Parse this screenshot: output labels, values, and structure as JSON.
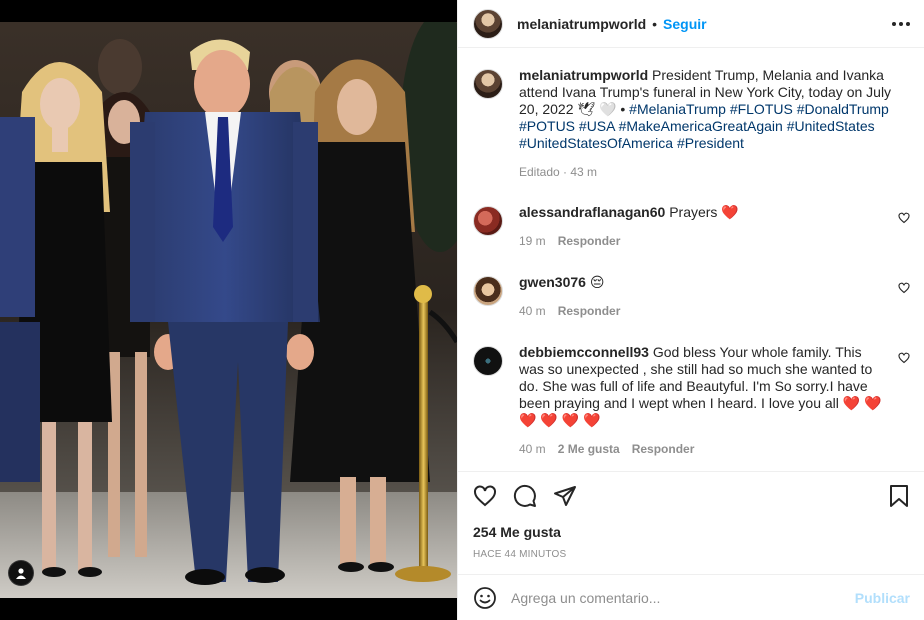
{
  "post": {
    "username": "melaniatrumpworld",
    "follow_label": "Seguir",
    "dot": "•",
    "caption": "President Trump, Melania and Ivanka attend Ivana Trump's funeral in New York City, today on July 20, 2022",
    "caption_sep": "🕊 🤍 •",
    "hashtags": [
      "#MelaniaTrump",
      "#FLOTUS",
      "#DonaldTrump",
      "#POTUS",
      "#USA",
      "#MakeAmericaGreatAgain",
      "#UnitedStates",
      "#UnitedStatesOfAmerica",
      "#President"
    ],
    "caption_meta": "Editado · 43 m"
  },
  "comments": [
    {
      "username": "alessandraflanagan60",
      "text": "Prayers ❤️",
      "time": "19 m",
      "reply": "Responder"
    },
    {
      "username": "gwen3076",
      "text": "😔",
      "time": "40 m",
      "reply": "Responder"
    },
    {
      "username": "debbiemcconnell93",
      "text": "God bless Your whole family. This was so unexpected , she still had so much she wanted to do. She was full of life and Beautyful. I'm So sorry.I have been praying and I wept when I heard. I love you all ❤️ ❤️ ❤️ ❤️ ❤️ ❤️",
      "time": "40 m",
      "likes": "2 Me gusta",
      "reply": "Responder"
    }
  ],
  "actions": {
    "icons": [
      "heart-icon",
      "comment-icon",
      "share-icon",
      "bookmark-icon"
    ],
    "likes": "254 Me gusta",
    "time": "HACE 44 MINUTOS"
  },
  "composer": {
    "placeholder": "Agrega un comentario...",
    "publish": "Publicar",
    "emoji_icon": "smiley-icon"
  },
  "colors": {
    "accent": "#0095f6",
    "publish_disabled": "#b2dffc",
    "hashtag": "#00376b",
    "muted": "#8e8e8e"
  }
}
